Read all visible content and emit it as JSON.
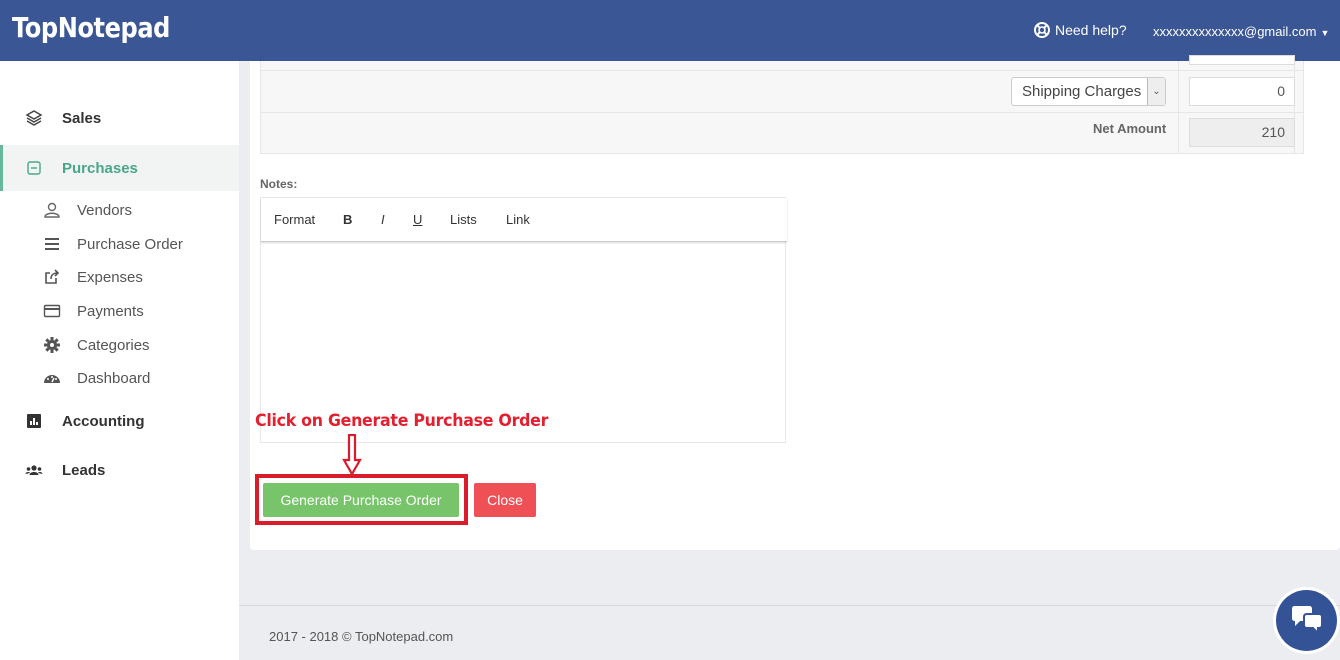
{
  "header": {
    "logo": "TopNotepad",
    "help_label": "Need help?",
    "account_email": "xxxxxxxxxxxxxx@gmail.com"
  },
  "sidebar": {
    "sales": "Sales",
    "purchases": "Purchases",
    "sub_items": [
      "Vendors",
      "Purchase Order",
      "Expenses",
      "Payments",
      "Categories",
      "Dashboard"
    ],
    "accounting": "Accounting",
    "leads": "Leads"
  },
  "totals": {
    "shipping_select": "Shipping Charges",
    "shipping_value": "0",
    "net_amount_label": "Net Amount",
    "net_amount_value": "210"
  },
  "notes": {
    "label": "Notes:",
    "toolbar": [
      "Format",
      "B",
      "I",
      "U",
      "Lists",
      "Link"
    ]
  },
  "annotation": "Click on Generate Purchase Order",
  "actions": {
    "generate": "Generate Purchase Order",
    "close": "Close"
  },
  "footer": "2017 - 2018 © TopNotepad.com",
  "colors": {
    "header": "#3a5694",
    "accent": "#4aa68b",
    "generate_button": "#78c46a",
    "close_button": "#ee5056",
    "annotation": "#e3202f"
  }
}
